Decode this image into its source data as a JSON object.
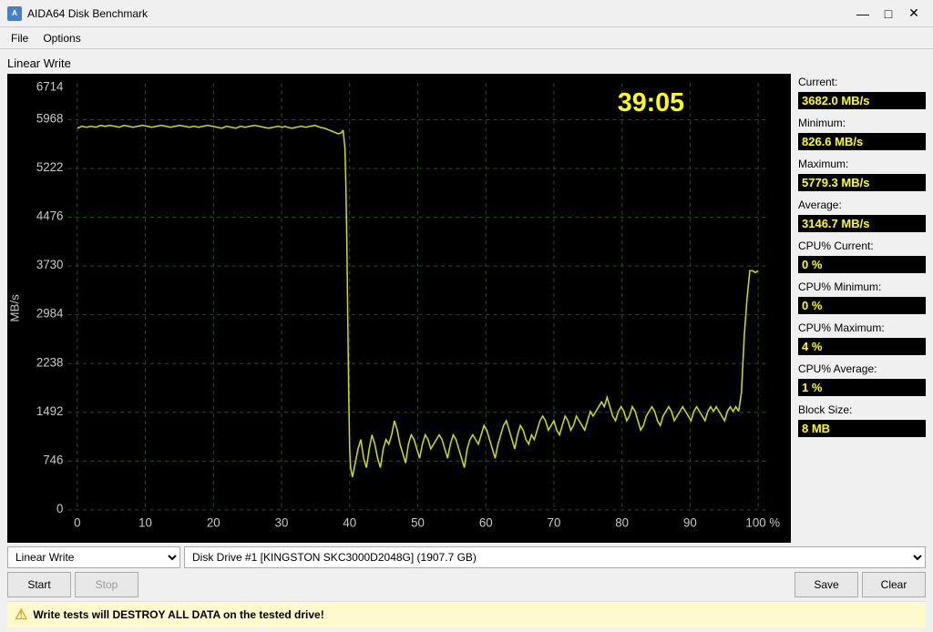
{
  "window": {
    "title": "AIDA64 Disk Benchmark",
    "icon_label": "A"
  },
  "titlebar_buttons": {
    "minimize": "—",
    "maximize": "□",
    "close": "✕"
  },
  "menu": {
    "items": [
      "File",
      "Options"
    ]
  },
  "section": {
    "title": "Linear Write"
  },
  "chart": {
    "timer": "39:05",
    "y_labels": [
      "6714",
      "5968",
      "5222",
      "4476",
      "3730",
      "2984",
      "2238",
      "1492",
      "746",
      "0"
    ],
    "x_labels": [
      "0",
      "10",
      "20",
      "30",
      "40",
      "50",
      "60",
      "70",
      "80",
      "90",
      "100 %"
    ],
    "y_axis_label": "MB/s"
  },
  "stats": {
    "current_label": "Current:",
    "current_value": "3682.0 MB/s",
    "minimum_label": "Minimum:",
    "minimum_value": "826.6 MB/s",
    "maximum_label": "Maximum:",
    "maximum_value": "5779.3 MB/s",
    "average_label": "Average:",
    "average_value": "3146.7 MB/s",
    "cpu_current_label": "CPU% Current:",
    "cpu_current_value": "0 %",
    "cpu_minimum_label": "CPU% Minimum:",
    "cpu_minimum_value": "0 %",
    "cpu_maximum_label": "CPU% Maximum:",
    "cpu_maximum_value": "4 %",
    "cpu_average_label": "CPU% Average:",
    "cpu_average_value": "1 %",
    "block_size_label": "Block Size:",
    "block_size_value": "8 MB"
  },
  "controls": {
    "test_type": "Linear Write",
    "drive": "Disk Drive #1  [KINGSTON SKC3000D2048G]  (1907.7 GB)",
    "start_label": "Start",
    "stop_label": "Stop",
    "save_label": "Save",
    "clear_label": "Clear"
  },
  "warning": {
    "text": "Write tests will DESTROY ALL DATA on the tested drive!"
  }
}
